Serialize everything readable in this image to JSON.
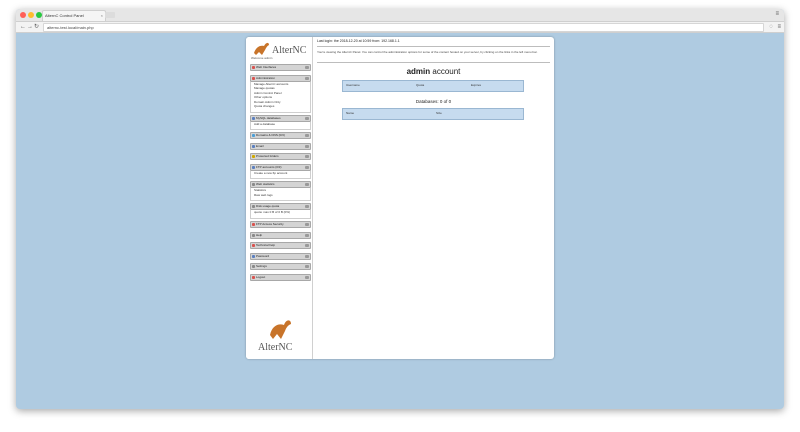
{
  "browser": {
    "tab_title": "AlternC Control Panel",
    "url": "alternc-test.local/main.php",
    "tab_close": "×",
    "menu_glyph": "≡"
  },
  "brand": {
    "logo_text": "AlterNC",
    "welcome": "Welcome admin"
  },
  "sidebar": {
    "sections": [
      {
        "label": "Web Interfaces",
        "icon_color": "#d9534f"
      },
      {
        "label": "Administration",
        "icon_color": "#d9534f",
        "items": [
          "Manage AlternC accounts",
          "Manage quotas",
          "Admin Control Panel",
          "Other options",
          "Domain Admin Only",
          "Quota changes"
        ]
      },
      {
        "label": "MySQL databases",
        "icon_color": "#5b7fbf",
        "items": [
          "Add a database"
        ]
      },
      {
        "label": "Domains & DNS (0/3)",
        "icon_color": "#4c9fd6"
      },
      {
        "label": "Email",
        "icon_color": "#5b7fbf"
      },
      {
        "label": "Protected folders",
        "icon_color": "#d0a800"
      },
      {
        "label": "FTP accounts (0/3)",
        "icon_color": "#5b7fbf",
        "items": [
          "Create a new ftp account"
        ]
      },
      {
        "label": "Web statistics",
        "icon_color": "#8a8a8a",
        "items": [
          "Statistics",
          "Raw web logs"
        ]
      },
      {
        "label": "Disk usage quota",
        "icon_color": "#8a8a8a",
        "items": [
          "quota: max 0 B of 0 B (0%)"
        ]
      },
      {
        "label": "FTP Access Security",
        "icon_color": "#d9534f"
      },
      {
        "label": "Help",
        "icon_color": "#8a8a8a"
      },
      {
        "label": "Technical help",
        "icon_color": "#d9534f"
      },
      {
        "label": "Password",
        "icon_color": "#5b7fbf"
      },
      {
        "label": "Settings",
        "icon_color": "#8a8a8a"
      },
      {
        "label": "Logout",
        "icon_color": "#d9534f"
      }
    ]
  },
  "main": {
    "last_login": "Last login: the 2018-12-20 at 10:59 from: 192.168.1.1",
    "notice": "You're viewing the AlternC Panel. You can control the administration options for some of the content hosted on your server, by clicking on the links in the left menu bar.",
    "account_title_user": "admin",
    "account_title_suffix": "account",
    "account_table": {
      "col1": "Username",
      "col2": "Quota",
      "col3": "Expires"
    },
    "databases_title": "Databases: 0 of 0",
    "db_table": {
      "col1": "Name",
      "col2": "Size"
    }
  }
}
